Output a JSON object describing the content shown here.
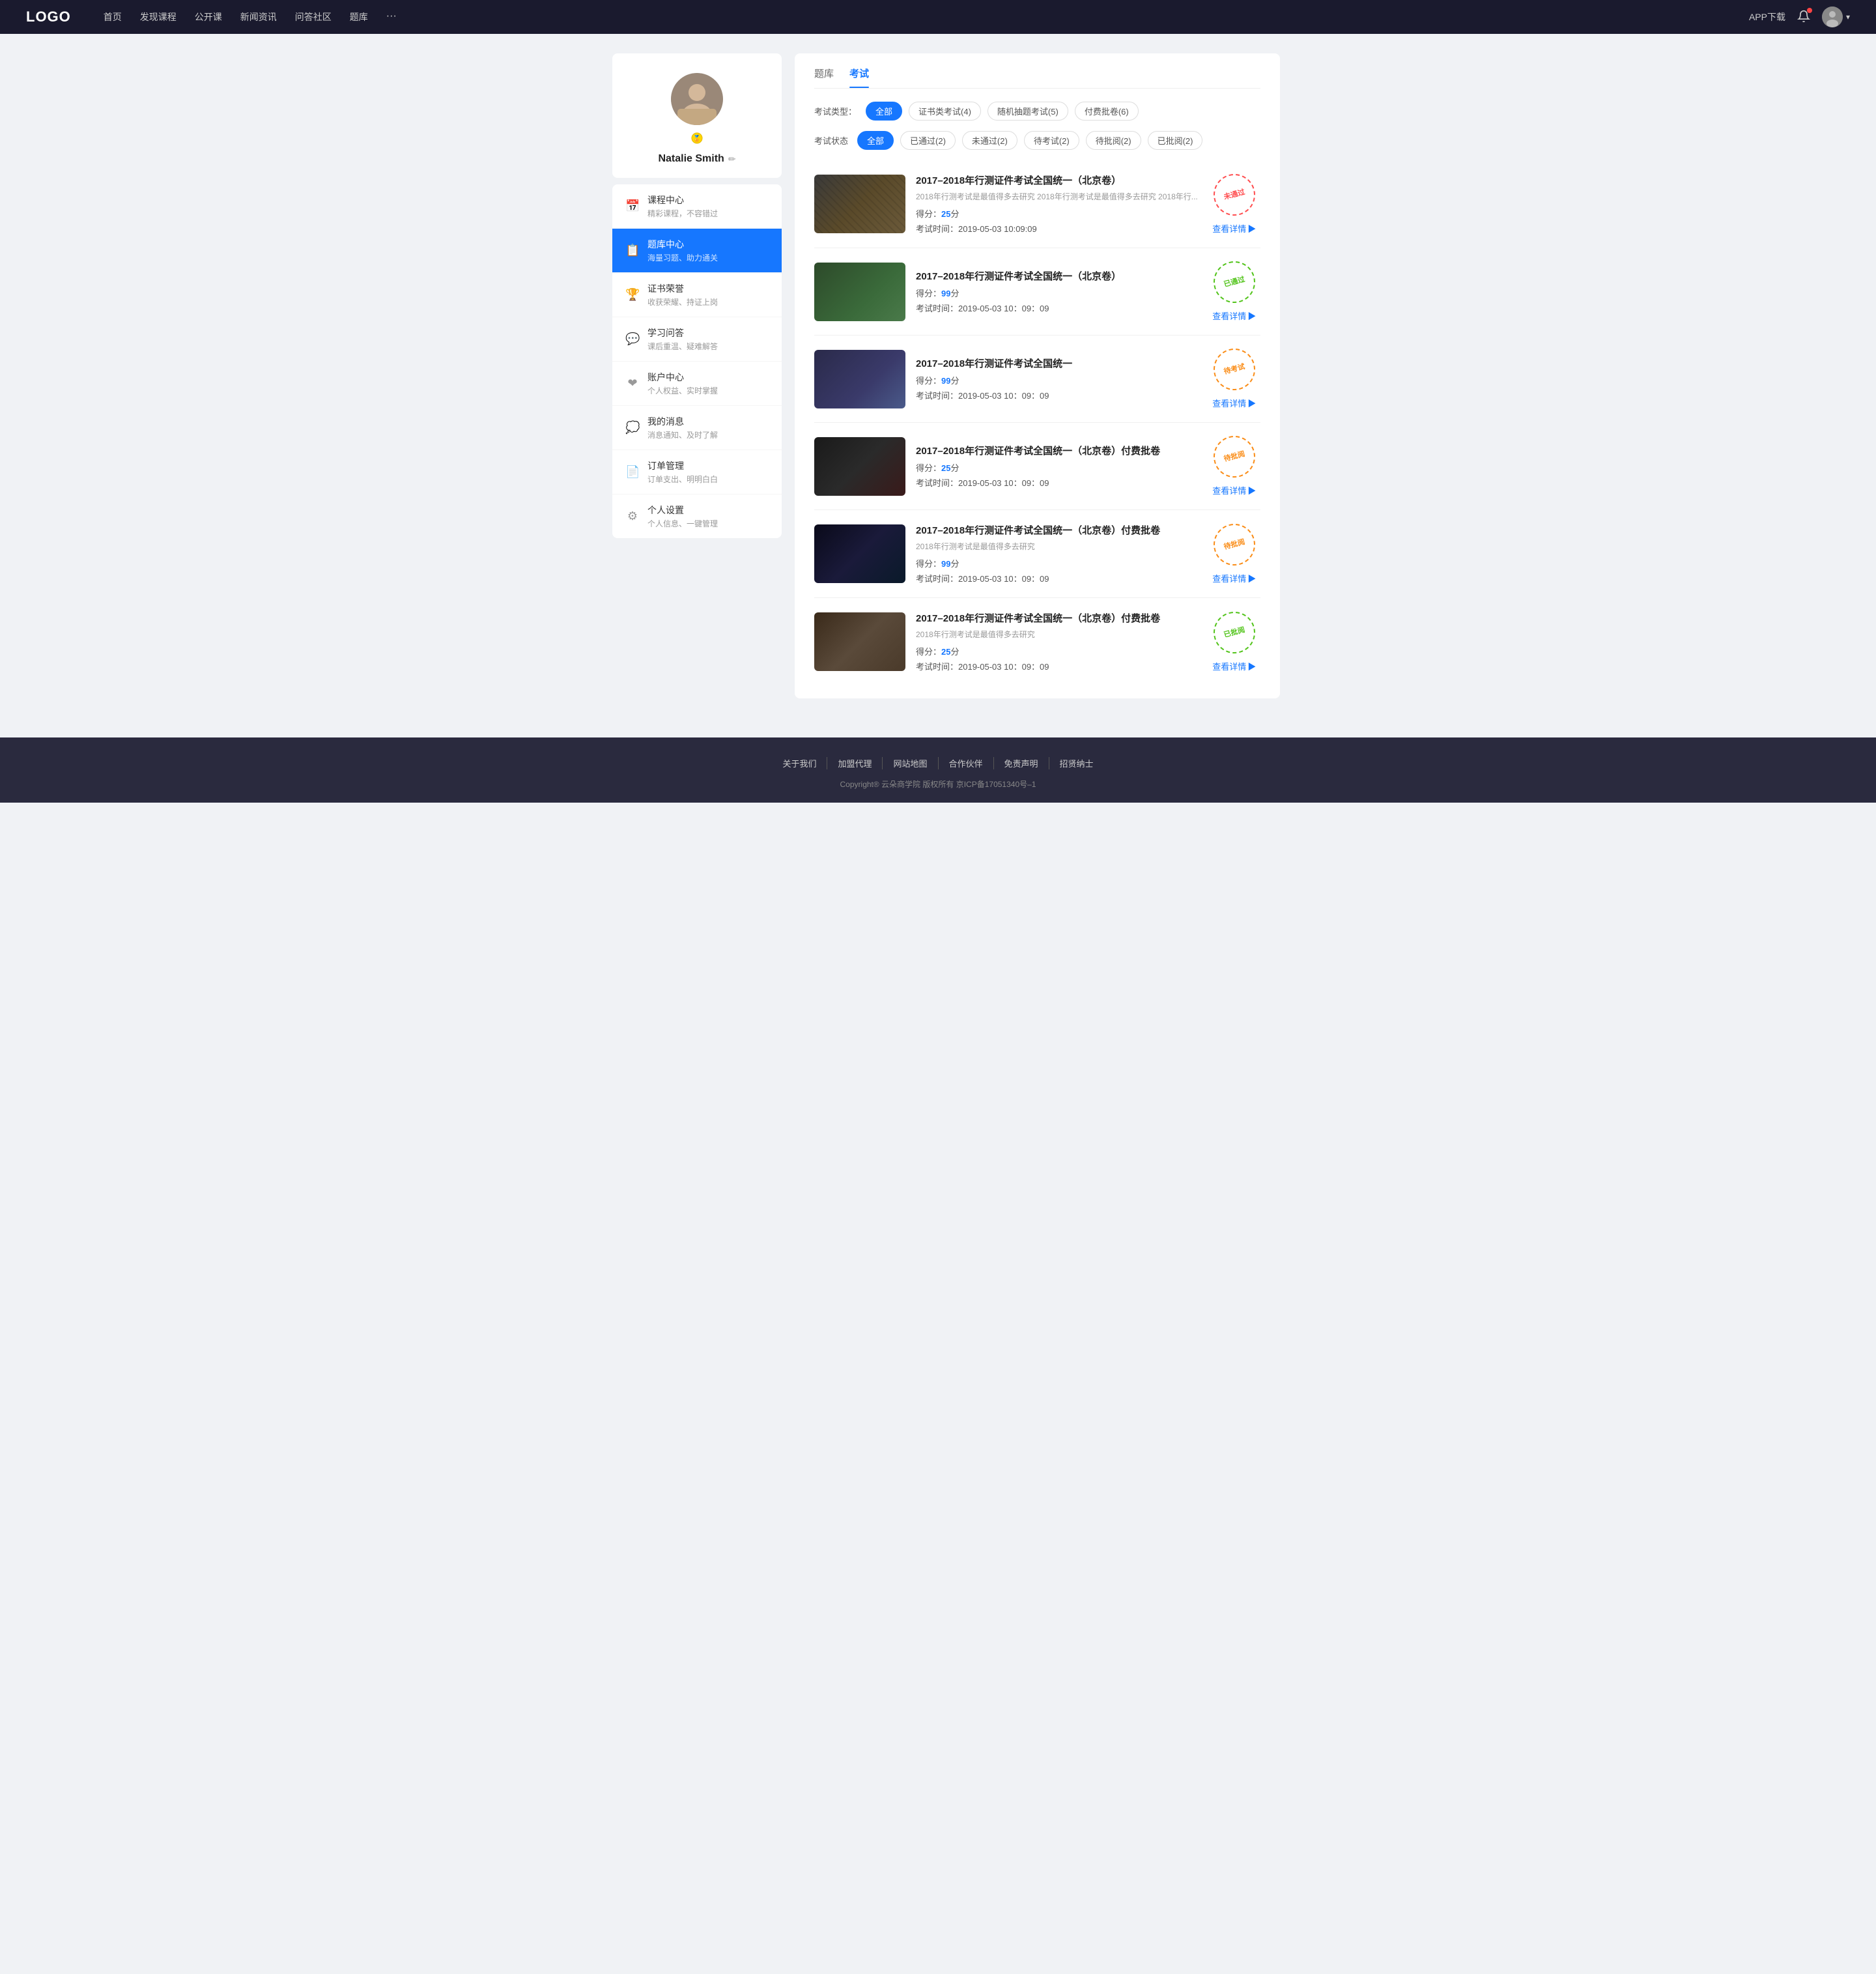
{
  "navbar": {
    "logo": "LOGO",
    "links": [
      "首页",
      "发现课程",
      "公开课",
      "新闻资讯",
      "问答社区",
      "题库"
    ],
    "more": "···",
    "app_download": "APP下载"
  },
  "sidebar": {
    "username": "Natalie Smith",
    "menu_items": [
      {
        "id": "course",
        "icon": "📅",
        "title": "课程中心",
        "sub": "精彩课程，不容错过",
        "active": false
      },
      {
        "id": "question-bank",
        "icon": "📋",
        "title": "题库中心",
        "sub": "海量习题、助力通关",
        "active": true
      },
      {
        "id": "certificate",
        "icon": "🏆",
        "title": "证书荣誉",
        "sub": "收获荣耀、持证上岗",
        "active": false
      },
      {
        "id": "qa",
        "icon": "💬",
        "title": "学习问答",
        "sub": "课后重温、疑难解答",
        "active": false
      },
      {
        "id": "account",
        "icon": "❤",
        "title": "账户中心",
        "sub": "个人权益、实时掌握",
        "active": false
      },
      {
        "id": "messages",
        "icon": "💭",
        "title": "我的消息",
        "sub": "消息通知、及时了解",
        "active": false
      },
      {
        "id": "orders",
        "icon": "📄",
        "title": "订单管理",
        "sub": "订单支出、明明白白",
        "active": false
      },
      {
        "id": "settings",
        "icon": "⚙",
        "title": "个人设置",
        "sub": "个人信息、一键管理",
        "active": false
      }
    ]
  },
  "main": {
    "tabs": [
      {
        "label": "题库",
        "active": false
      },
      {
        "label": "考试",
        "active": true
      }
    ],
    "exam_type_label": "考试类型：",
    "exam_type_filters": [
      {
        "label": "全部",
        "active": true
      },
      {
        "label": "证书类考试(4)",
        "active": false
      },
      {
        "label": "随机抽题考试(5)",
        "active": false
      },
      {
        "label": "付费批卷(6)",
        "active": false
      }
    ],
    "exam_status_label": "考试状态",
    "exam_status_filters": [
      {
        "label": "全部",
        "active": true
      },
      {
        "label": "已通过(2)",
        "active": false
      },
      {
        "label": "未通过(2)",
        "active": false
      },
      {
        "label": "待考试(2)",
        "active": false
      },
      {
        "label": "待批阅(2)",
        "active": false
      },
      {
        "label": "已批阅(2)",
        "active": false
      }
    ],
    "exams": [
      {
        "title": "2017–2018年行测证件考试全国统一（北京卷）",
        "desc": "2018年行测考试是最值得多去研究 2018年行测考试是最值得多去研究 2018年行...",
        "score_label": "得分：",
        "score": "25",
        "score_unit": "分",
        "time_label": "考试时间：",
        "time": "2019-05-03  10:09:09",
        "stamp_type": "not-passed",
        "stamp_text": "未通过",
        "detail_label": "查看详情",
        "thumb_class": "thumb-1"
      },
      {
        "title": "2017–2018年行测证件考试全国统一（北京卷）",
        "desc": "",
        "score_label": "得分：",
        "score": "99",
        "score_unit": "分",
        "time_label": "考试时间：",
        "time": "2019-05-03  10：09：09",
        "stamp_type": "passed",
        "stamp_text": "已通过",
        "detail_label": "查看详情",
        "thumb_class": "thumb-2"
      },
      {
        "title": "2017–2018年行测证件考试全国统一",
        "desc": "",
        "score_label": "得分：",
        "score": "99",
        "score_unit": "分",
        "time_label": "考试时间：",
        "time": "2019-05-03  10：09：09",
        "stamp_type": "pending",
        "stamp_text": "待考试",
        "detail_label": "查看详情",
        "thumb_class": "thumb-3"
      },
      {
        "title": "2017–2018年行测证件考试全国统一（北京卷）付费批卷",
        "desc": "",
        "score_label": "得分：",
        "score": "25",
        "score_unit": "分",
        "time_label": "考试时间：",
        "time": "2019-05-03  10：09：09",
        "stamp_type": "reviewing",
        "stamp_text": "待批阅",
        "detail_label": "查看详情",
        "thumb_class": "thumb-4"
      },
      {
        "title": "2017–2018年行测证件考试全国统一（北京卷）付费批卷",
        "desc": "2018年行测考试是最值得多去研究",
        "score_label": "得分：",
        "score": "99",
        "score_unit": "分",
        "time_label": "考试时间：",
        "time": "2019-05-03  10：09：09",
        "stamp_type": "reviewing",
        "stamp_text": "待批阅",
        "detail_label": "查看详情",
        "thumb_class": "thumb-5"
      },
      {
        "title": "2017–2018年行测证件考试全国统一（北京卷）付费批卷",
        "desc": "2018年行测考试是最值得多去研究",
        "score_label": "得分：",
        "score": "25",
        "score_unit": "分",
        "time_label": "考试时间：",
        "time": "2019-05-03  10：09：09",
        "stamp_type": "reviewed",
        "stamp_text": "已批阅",
        "detail_label": "查看详情",
        "thumb_class": "thumb-6"
      }
    ]
  },
  "footer": {
    "links": [
      "关于我们",
      "加盟代理",
      "网站地图",
      "合作伙伴",
      "免责声明",
      "招贤纳士"
    ],
    "copyright": "Copyright® 云朵商学院  版权所有    京ICP备17051340号–1"
  }
}
